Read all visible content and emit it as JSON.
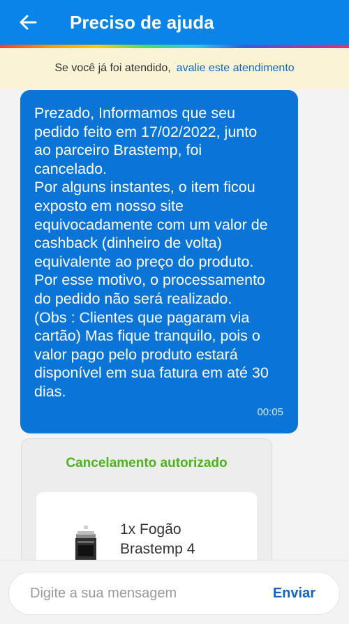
{
  "header": {
    "title": "Preciso de ajuda",
    "back_icon": "arrow-left-icon",
    "background": "#0a84e8"
  },
  "rating_banner": {
    "text": "Se você já foi atendido,",
    "link": "avalie este atendimento"
  },
  "messages": [
    {
      "text": "Prezado, Informamos que seu\npedido feito em 17/02/2022, junto\nao parceiro Brastemp, foi\ncancelado.\nPor alguns instantes, o item ficou\nexposto em nosso site\nequivocadamente com um valor de\ncashback (dinheiro de volta)\nequivalente ao preço do produto.\nPor esse motivo, o processamento\ndo pedido não será realizado.\n(Obs : Clientes que pagaram via\ncartão) Mas fique tranquilo, pois o\nvalor pago pelo produto estará\ndisponível em sua fatura em até 30\ndias.",
      "time": "00:05"
    }
  ],
  "cancel_card": {
    "title": "Cancelamento autorizado",
    "title_color": "#4cb31c",
    "product": {
      "name": "1x Fogão\nBrastemp 4",
      "icon": "stove-icon"
    }
  },
  "composer": {
    "placeholder": "Digite a sua mensagem",
    "send_label": "Enviar"
  }
}
